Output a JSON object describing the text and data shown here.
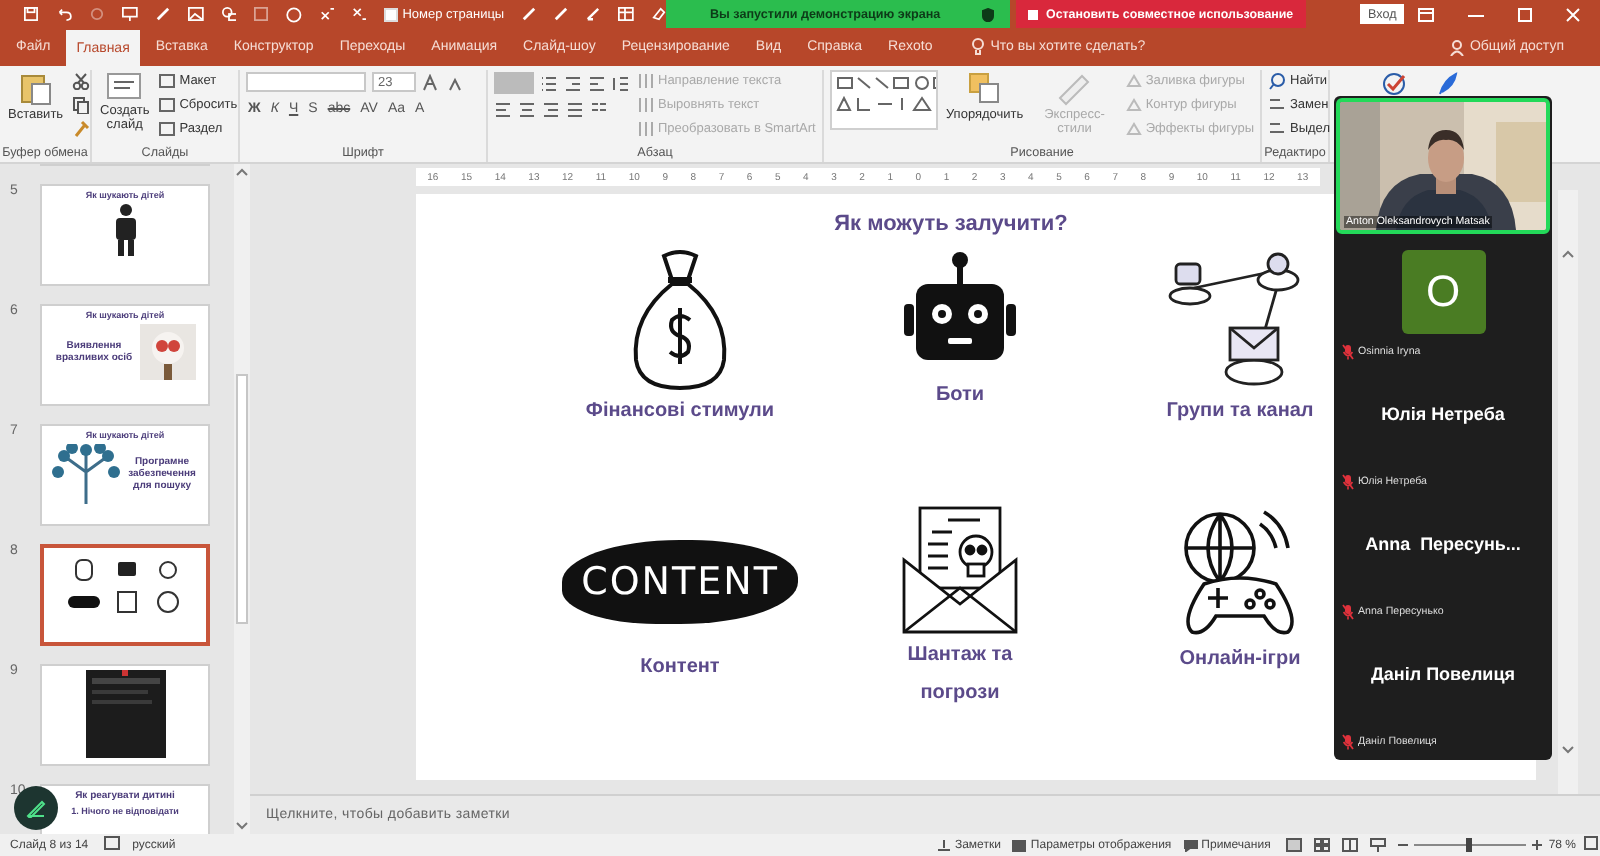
{
  "title_bar": {
    "page_number": {
      "label": "Номер страницы",
      "checked": false
    },
    "share_banner": "Вы запустили демонстрацию экрана",
    "stop_share": "Остановить совместное использование",
    "sign_in": "Вход"
  },
  "tabs": [
    {
      "label": "Файл",
      "selected": false
    },
    {
      "label": "Главная",
      "selected": true
    },
    {
      "label": "Вставка",
      "selected": false
    },
    {
      "label": "Конструктор",
      "selected": false
    },
    {
      "label": "Переходы",
      "selected": false
    },
    {
      "label": "Анимация",
      "selected": false
    },
    {
      "label": "Слайд-шоу",
      "selected": false
    },
    {
      "label": "Рецензирование",
      "selected": false
    },
    {
      "label": "Вид",
      "selected": false
    },
    {
      "label": "Справка",
      "selected": false
    },
    {
      "label": "Rexoto",
      "selected": false
    }
  ],
  "tell_me": "Что вы хотите сделать?",
  "share": "Общий доступ",
  "ribbon": {
    "groups": [
      {
        "kind": "clipboard",
        "label": "Буфер обмена",
        "items": [
          {
            "label": "Вставить",
            "disabled": false
          }
        ]
      },
      {
        "kind": "slides",
        "label": "Слайды",
        "items": [
          {
            "label": "Создать слайд",
            "disabled": false
          },
          {
            "label": "Макет",
            "disabled": false
          },
          {
            "label": "Сбросить",
            "disabled": false
          },
          {
            "label": "Раздел",
            "disabled": false
          }
        ]
      },
      {
        "kind": "font",
        "label": "Шрифт",
        "font_size": "23",
        "items": [
          {
            "label": "Ж"
          },
          {
            "label": "К"
          },
          {
            "label": "Ч"
          },
          {
            "label": "S"
          },
          {
            "label": "abc"
          },
          {
            "label": "AV"
          },
          {
            "label": "Aa"
          },
          {
            "label": "A"
          }
        ]
      },
      {
        "kind": "paragraph",
        "label": "Абзац",
        "items": [
          {
            "label": "Направление текста",
            "disabled": true
          },
          {
            "label": "Выровнять текст",
            "disabled": true
          },
          {
            "label": "Преобразовать в SmartArt",
            "disabled": true
          }
        ]
      },
      {
        "kind": "drawing",
        "label": "Рисование",
        "items": [
          {
            "label": "Упорядочить",
            "disabled": false
          },
          {
            "label": "Экспресс-стили",
            "disabled": true
          },
          {
            "label": "Заливка фигуры",
            "disabled": true
          },
          {
            "label": "Контур фигуры",
            "disabled": true
          },
          {
            "label": "Эффекты фигуры",
            "disabled": true
          }
        ]
      },
      {
        "kind": "editing",
        "label": "Редактиро",
        "items": [
          {
            "label": "Найти",
            "disabled": false
          },
          {
            "label": "Замен",
            "disabled": false
          },
          {
            "label": "Выдел",
            "disabled": false
          }
        ]
      }
    ]
  },
  "ruler": [
    "16",
    "15",
    "14",
    "13",
    "12",
    "11",
    "10",
    "9",
    "8",
    "7",
    "6",
    "5",
    "4",
    "3",
    "2",
    "1",
    "0",
    "1",
    "2",
    "3",
    "4",
    "5",
    "6",
    "7",
    "8",
    "9",
    "10",
    "11",
    "12",
    "13"
  ],
  "thumbnails": [
    {
      "number": "5",
      "kind": "person",
      "title": "Як шукають дітей",
      "selected": false
    },
    {
      "number": "6",
      "title": "Як шукають дітей",
      "body": "Виявлення вразливих осіб",
      "selected": false
    },
    {
      "number": "7",
      "kind": "tree",
      "title": "Як шукають дітей",
      "body": "Програмне забезпечення для пошуку",
      "selected": false
    },
    {
      "number": "8",
      "kind": "grid",
      "selected": true
    },
    {
      "number": "9",
      "kind": "screenshot",
      "selected": false
    },
    {
      "number": "10",
      "kind": "text",
      "title": "Як реагувати дитині",
      "body": "1. Нічого не відповідати",
      "selected": false
    }
  ],
  "slide": {
    "title": "Як можуть залучити?",
    "items": [
      {
        "kind": "money_bag",
        "label": "Фінансові стимули"
      },
      {
        "kind": "robot",
        "label": "Боти"
      },
      {
        "kind": "network",
        "label": "Групи та канал"
      },
      {
        "kind": "content",
        "label": "Контент",
        "badge": "CONTENT"
      },
      {
        "kind": "blackmail",
        "label": "Шантаж та погрози"
      },
      {
        "kind": "gamepad",
        "label": "Онлайн-ігри"
      }
    ]
  },
  "notes_placeholder": "Щелкните, чтобы добавить заметки",
  "status_bar": {
    "slide_counter": "Слайд 8 из 14",
    "language": "русский",
    "notes": "Заметки",
    "display_settings": "Параметры отображения",
    "comments": "Примечания",
    "zoom": {
      "level": 0.45,
      "reading": "78 %"
    }
  },
  "meeting": {
    "presenter": "Anton Oleksandrovych Matsak",
    "participants": [
      {
        "kind": "avatar",
        "avatar": "O",
        "label": "Osinnia Iryna",
        "muted": true
      },
      {
        "kind": "name",
        "display": "Юлія Нетреба",
        "label": "Юлія Нетреба",
        "muted": true
      },
      {
        "kind": "name",
        "display": "Anna  Пересунь...",
        "label": "Anna Пересунько",
        "muted": true
      },
      {
        "kind": "name",
        "display": "Даніл Повелиця",
        "label": "Даніл Повелиця",
        "muted": true
      }
    ]
  }
}
